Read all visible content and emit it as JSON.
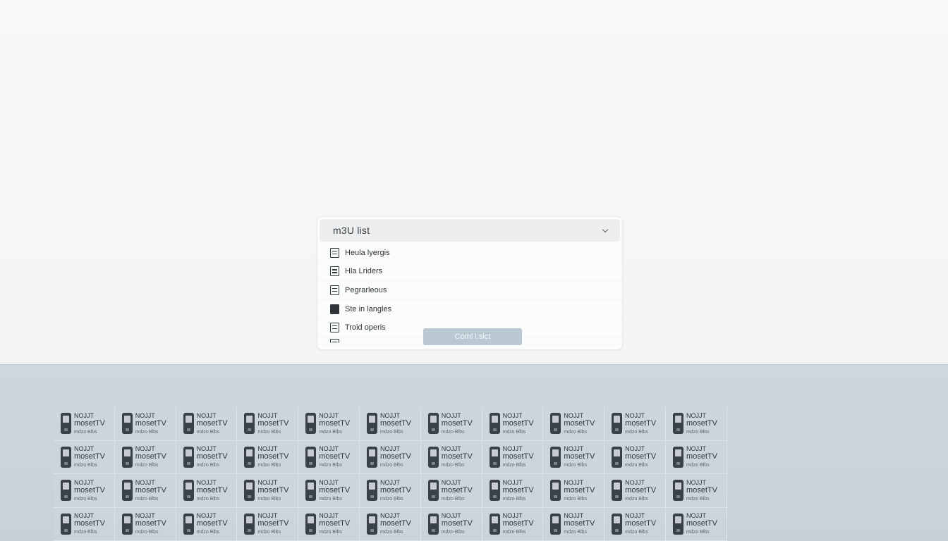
{
  "dropdown": {
    "title": "m3U list",
    "items": [
      {
        "label": "Heula lyergis",
        "icon": "list-icon"
      },
      {
        "label": "Hla Lriders",
        "icon": "list-icon"
      },
      {
        "label": "Pegrarleous",
        "icon": "list-icon"
      },
      {
        "label": "Ste in langles",
        "icon": "square-icon"
      },
      {
        "label": "Troid operis",
        "icon": "list-icon"
      }
    ],
    "button_label": "Coml l.sict"
  },
  "grid": {
    "rows": 4,
    "columns": 11,
    "tile": {
      "line1": "NOJJT",
      "line2": "mosetTV",
      "line3": "mdzo Blbs",
      "icon": "phone-icon"
    }
  }
}
